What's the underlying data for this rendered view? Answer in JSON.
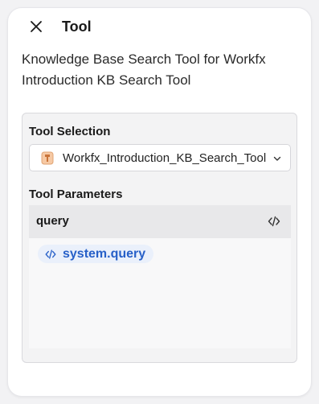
{
  "header": {
    "title": "Tool",
    "close_icon": "close-icon"
  },
  "description": "Knowledge Base Search Tool for Workfx Introduction KB Search Tool",
  "tool_selection": {
    "label": "Tool Selection",
    "selected_value": "Workfx_Introduction_KB_Search_Tool",
    "tool_icon": "tool-icon",
    "dropdown_icon": "chevron-down-icon"
  },
  "tool_parameters": {
    "label": "Tool Parameters",
    "params": [
      {
        "name": "query",
        "code_icon": "code-icon",
        "variable": "system.query"
      }
    ]
  },
  "colors": {
    "variable_text": "#2760c8",
    "variable_bg": "#eaf0fb",
    "tool_icon_fill": "#f6c9a4"
  }
}
